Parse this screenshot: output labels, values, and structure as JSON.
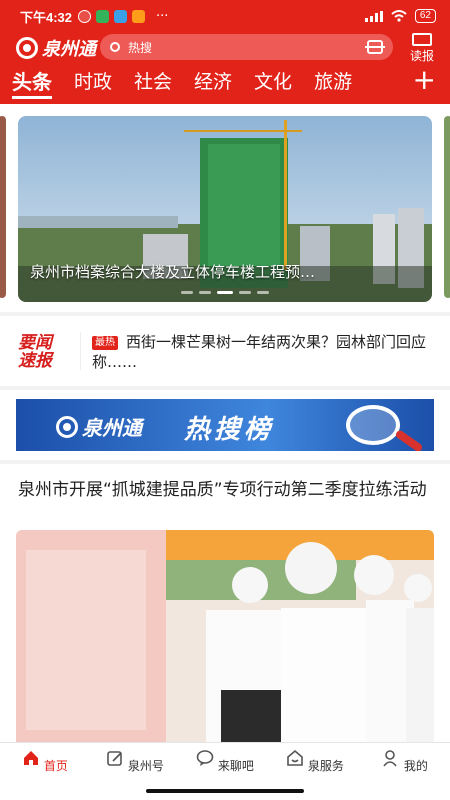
{
  "status_bar": {
    "time": "下午4:32",
    "more": "···",
    "battery": "62"
  },
  "header": {
    "logo_text": "泉州通",
    "search_placeholder": "热搜",
    "read_label": "读报"
  },
  "tabs": [
    {
      "label": "头条",
      "active": true
    },
    {
      "label": "时政",
      "active": false
    },
    {
      "label": "社会",
      "active": false
    },
    {
      "label": "经济",
      "active": false
    },
    {
      "label": "文化",
      "active": false
    },
    {
      "label": "旅游",
      "active": false
    }
  ],
  "add_tab_label": "+",
  "banner": {
    "caption": "泉州市档案综合大楼及立体停车楼工程预…",
    "slide_count": 5,
    "active_slide": 3
  },
  "news_ticker": {
    "brand_line1": "要闻",
    "brand_line2": "速报",
    "tag": "最热",
    "text": "西街一棵芒果树一年结两次果？园林部门回应称……"
  },
  "hot_banner": {
    "logo_text": "泉州通",
    "headline": "热搜榜"
  },
  "article": {
    "title": "泉州市开展“抓城建提品质”专项行动第二季度拉练活动"
  },
  "bottom_nav": [
    {
      "label": "首页",
      "icon": "home-icon",
      "active": true
    },
    {
      "label": "泉州号",
      "icon": "edit-icon",
      "active": false
    },
    {
      "label": "来聊吧",
      "icon": "chat-icon",
      "active": false
    },
    {
      "label": "泉服务",
      "icon": "service-icon",
      "active": false
    },
    {
      "label": "我的",
      "icon": "profile-icon",
      "active": false
    }
  ],
  "colors": {
    "brand_red": "#e2231a",
    "hot_blue": "#2b66c4"
  }
}
